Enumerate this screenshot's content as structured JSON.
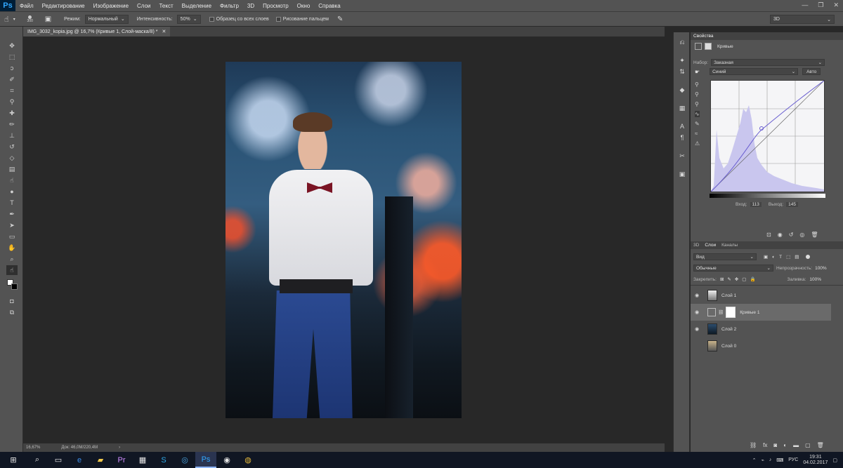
{
  "menubar": {
    "logo": "Ps",
    "items": [
      "Файл",
      "Редактирование",
      "Изображение",
      "Слои",
      "Текст",
      "Выделение",
      "Фильтр",
      "3D",
      "Просмотр",
      "Окно",
      "Справка"
    ],
    "window_controls": [
      "—",
      "❐",
      "✕"
    ]
  },
  "options": {
    "brush_size": "300",
    "mode_label": "Режим:",
    "mode_value": "Нормальный",
    "intensity_label": "Интенсивность:",
    "intensity_value": "50%",
    "sample_all_label": "Образец со всех слоев",
    "finger_label": "Рисование пальцем",
    "workspace_value": "3D"
  },
  "document": {
    "tab_title": "IMG_3032_kopia.jpg @ 16,7% (Кривые 1, Слой-маска/8) *",
    "zoom": "16,67%",
    "doc_info": "Док: 46,0M/220,4M"
  },
  "properties": {
    "tab_label": "Свойства",
    "adjustment_name": "Кривые",
    "preset_label": "Набор:",
    "preset_value": "Заказная",
    "channel_value": "Синий",
    "auto_button": "Авто",
    "input_label": "Вход:",
    "input_value": "113",
    "output_label": "Выход:",
    "output_value": "145"
  },
  "layers_panel": {
    "tabs": [
      "3D",
      "Слои",
      "Каналы"
    ],
    "filter_value": "Вид",
    "blend_mode": "Обычные",
    "opacity_label": "Непрозрачность:",
    "opacity_value": "100%",
    "lock_label": "Закрепить:",
    "fill_label": "Заливка:",
    "fill_value": "100%",
    "layers": [
      {
        "name": "Слой 1",
        "visible": true
      },
      {
        "name": "Кривые 1",
        "visible": true,
        "selected": true
      },
      {
        "name": "Слой 2",
        "visible": true
      },
      {
        "name": "Слой 0",
        "visible": false
      }
    ]
  },
  "taskbar": {
    "language": "РУС",
    "time": "19:31",
    "date": "04.02.2017"
  },
  "colors": {
    "ui_bg": "#535353",
    "canvas_bg": "#282828",
    "ps_blue": "#31a8ff",
    "curve_line": "#6a5fd0"
  }
}
